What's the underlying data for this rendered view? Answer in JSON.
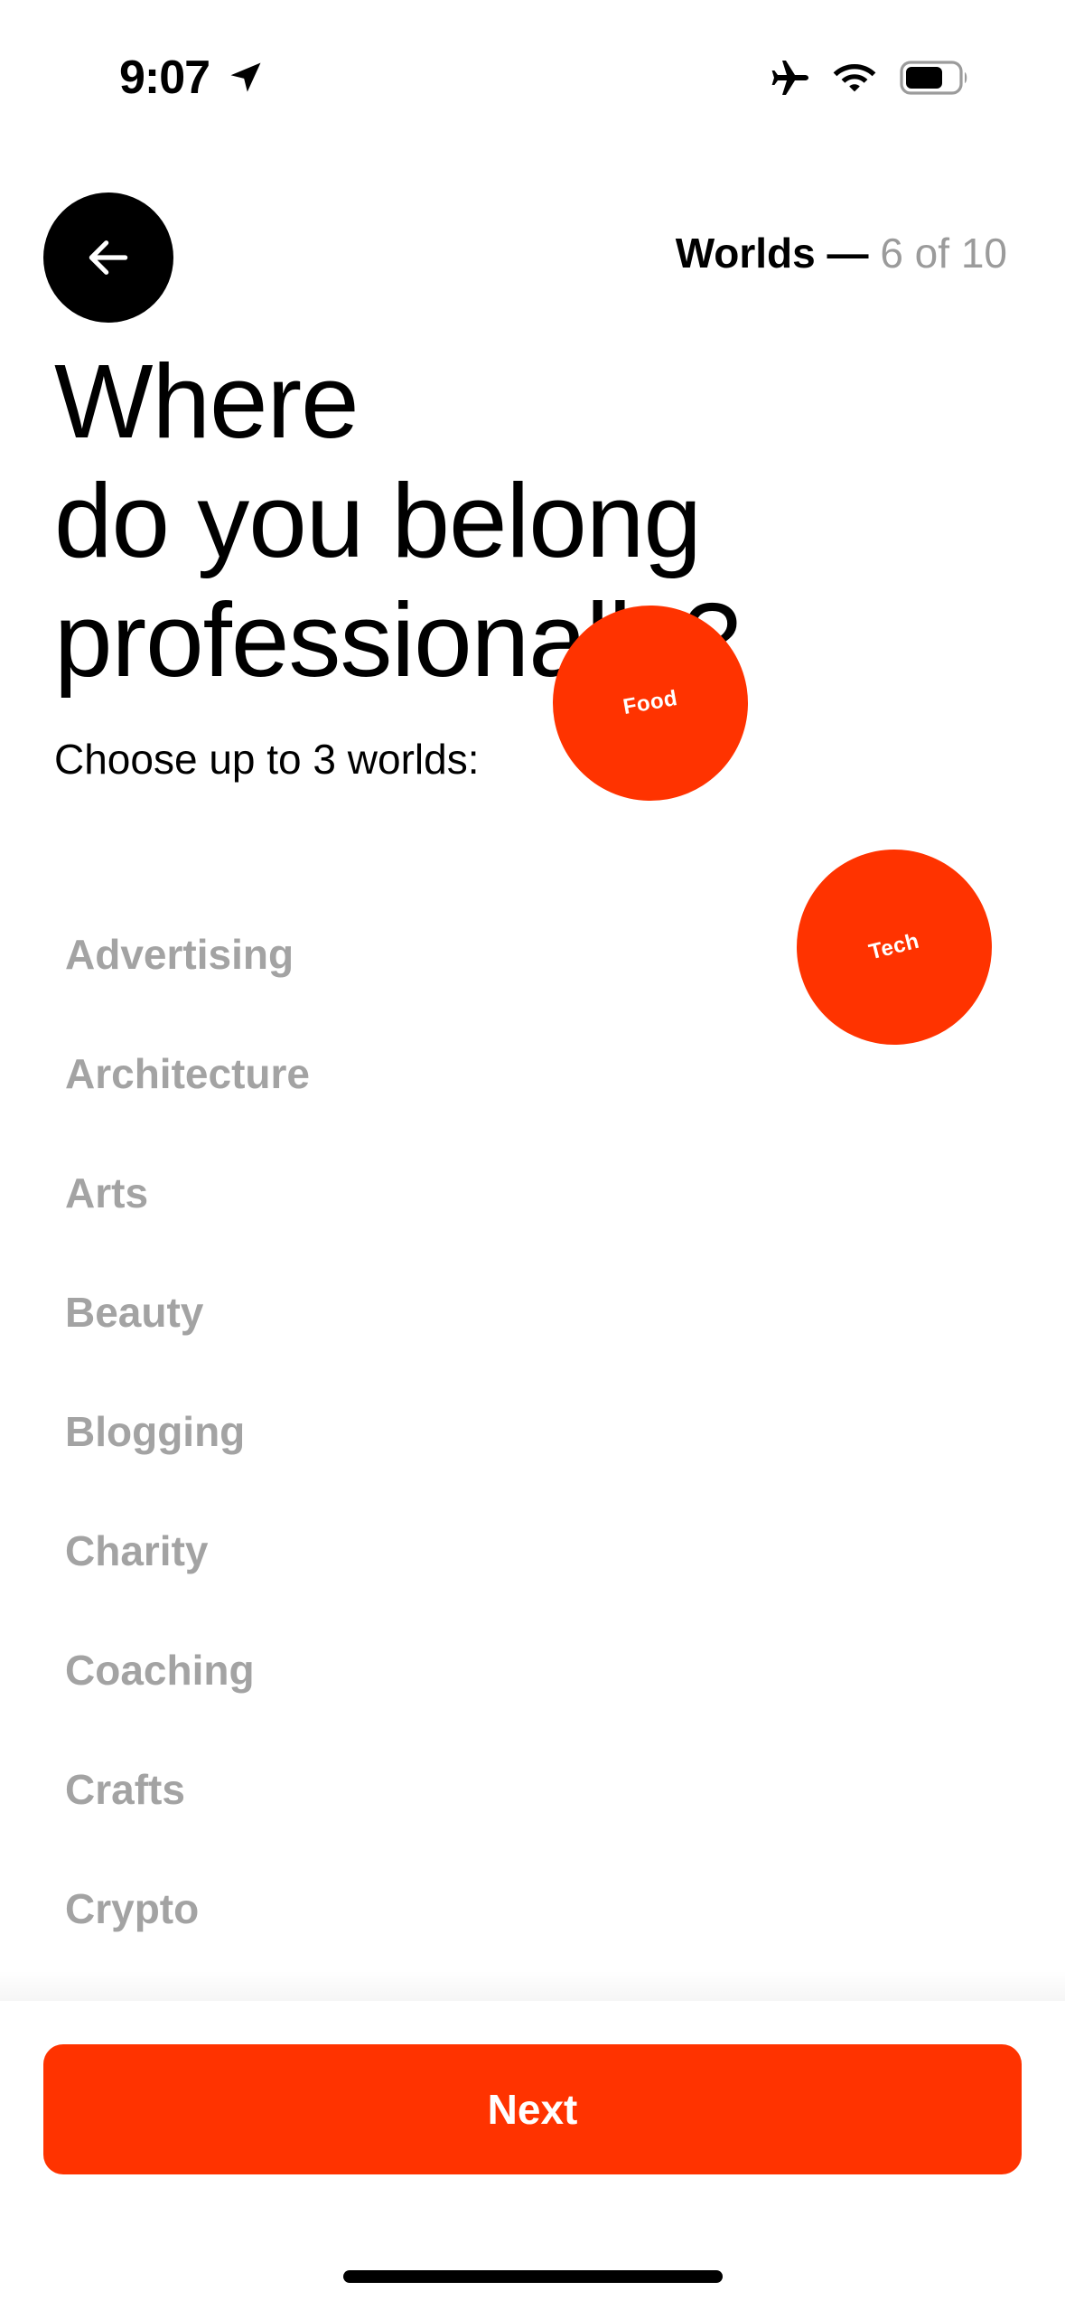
{
  "status_bar": {
    "time": "9:07",
    "icons": [
      "location-arrow-icon",
      "airplane-mode-icon",
      "wifi-icon",
      "battery-icon"
    ]
  },
  "header": {
    "back_icon": "arrow-left-icon",
    "section": "Worlds",
    "separator": "—",
    "step": "6 of 10"
  },
  "title_lines": [
    "Where",
    "do you belong",
    "professionally?"
  ],
  "subtitle": "Choose up to 3 worlds:",
  "selected_bubbles": [
    {
      "label": "Food"
    },
    {
      "label": "Tech"
    }
  ],
  "worlds": [
    {
      "label": "Advertising"
    },
    {
      "label": "Architecture"
    },
    {
      "label": "Arts"
    },
    {
      "label": "Beauty"
    },
    {
      "label": "Blogging"
    },
    {
      "label": "Charity"
    },
    {
      "label": "Coaching"
    },
    {
      "label": "Crafts"
    },
    {
      "label": "Crypto"
    }
  ],
  "next_button": {
    "label": "Next"
  },
  "colors": {
    "accent": "#ff3300",
    "text": "#000000",
    "muted_text": "#a3a3a3",
    "progress_muted": "#9b9b9b",
    "background": "#ffffff"
  }
}
